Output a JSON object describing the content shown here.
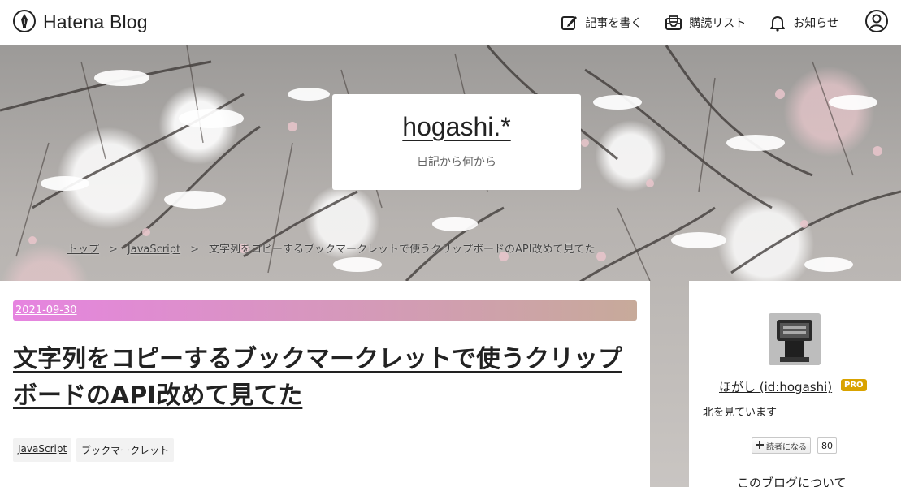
{
  "header": {
    "brand": "Hatena Blog",
    "nav": {
      "write": "記事を書く",
      "subscriptions": "購読リスト",
      "notifications": "お知らせ"
    }
  },
  "blog": {
    "title": "hogashi.*",
    "description": "日記から何から"
  },
  "breadcrumb": {
    "top": "トップ",
    "category": "JavaScript",
    "current": "文字列をコピーするブックマークレットで使うクリップボードのAPI改めて見てた"
  },
  "entry": {
    "date": "2021-09-30",
    "title": "文字列をコピーするブックマークレットで使うクリップボードのAPI改めて見てた",
    "tags": [
      "JavaScript",
      "ブックマークレット"
    ],
    "date_bar_colors": [
      "#e684e0",
      "#c7aa9a"
    ]
  },
  "sidebar": {
    "profile_name": "ほがし (id:hogashi)",
    "pro_badge": "PRO",
    "profile_description": "北を見ています",
    "reader_button": "読者になる",
    "reader_count": "80",
    "about_blog": "このブログについて"
  }
}
